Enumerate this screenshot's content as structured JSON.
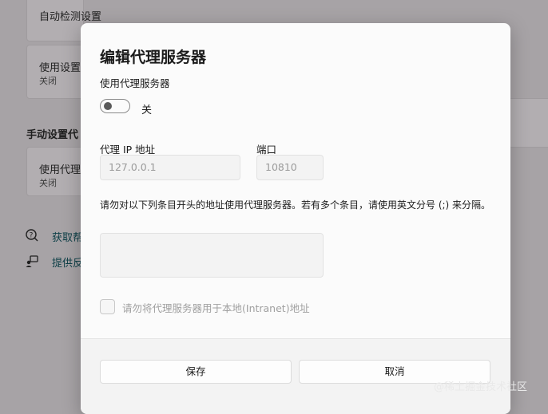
{
  "background": {
    "auto_detect_label": "自动检测设置",
    "use_script_label": "使用设置",
    "use_script_status": "关闭",
    "manual_section_title": "手动设置代",
    "use_proxy_label": "使用代理",
    "use_proxy_status": "关闭",
    "get_help_link": "获取帮",
    "feedback_link": "提供反"
  },
  "dialog": {
    "title": "编辑代理服务器",
    "use_proxy_label": "使用代理服务器",
    "toggle_state": "关",
    "ip_label": "代理 IP 地址",
    "ip_value": "127.0.0.1",
    "port_label": "端口",
    "port_value": "10810",
    "exceptions_desc": "请勿对以下列条目开头的地址使用代理服务器。若有多个条目，请使用英文分号 (;) 来分隔。",
    "exceptions_value": "",
    "local_bypass_label": "请勿将代理服务器用于本地(Intranet)地址",
    "save_button": "保存",
    "cancel_button": "取消"
  },
  "watermark": "@稀土掘金技术社区"
}
